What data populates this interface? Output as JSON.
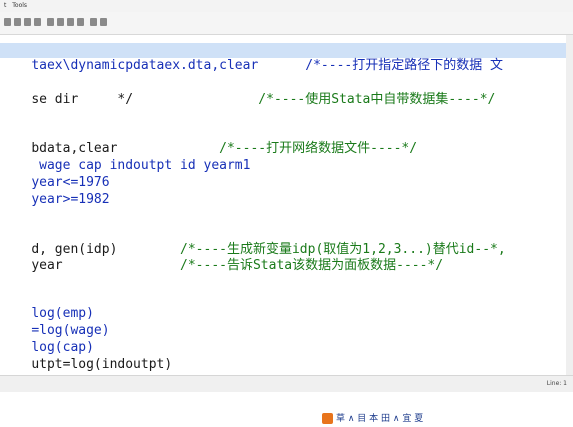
{
  "menu": {
    "items": [
      "t",
      "Tools"
    ]
  },
  "editor": {
    "lines": [
      {
        "code": "taex\\dynamicpdataex.dta,clear",
        "comment": "      /*----打开指定路径下的数据 文"
      },
      {
        "code": "",
        "comment": ""
      },
      {
        "code": "se dir     */",
        "comment": "                /*----使用Stata中自带数据集----*/"
      },
      {
        "code": "",
        "comment": ""
      },
      {
        "code": "",
        "comment": ""
      },
      {
        "code": "bdata,clear",
        "comment": "             /*----打开网络数据文件----*/"
      },
      {
        "code": " wage cap indoutpt id yearm1",
        "comment": ""
      },
      {
        "code": "year<=1976",
        "comment": ""
      },
      {
        "code": "year>=1982",
        "comment": ""
      },
      {
        "code": "",
        "comment": ""
      },
      {
        "code": "",
        "comment": ""
      },
      {
        "code": "",
        "comment": ""
      },
      {
        "code": "d, gen(idp)",
        "comment": "        /*----生成新变量idp(取值为1,2,3...)替代id--*,"
      },
      {
        "code": "year",
        "comment": "               /*----告诉Stata该数据为面板数据----*/"
      },
      {
        "code": "",
        "comment": ""
      },
      {
        "code": "",
        "comment": ""
      },
      {
        "code": "",
        "comment": ""
      },
      {
        "code": "log(emp)",
        "comment": ""
      },
      {
        "code": "=log(wage)",
        "comment": ""
      },
      {
        "code": "log(cap)",
        "comment": ""
      },
      {
        "code": "utpt=log(indoutpt)",
        "comment": ""
      }
    ]
  },
  "status": {
    "position": "Line: 1"
  },
  "watermark": {
    "text": "草 ∧ 目 本 田 ∧ 宜 夏"
  }
}
